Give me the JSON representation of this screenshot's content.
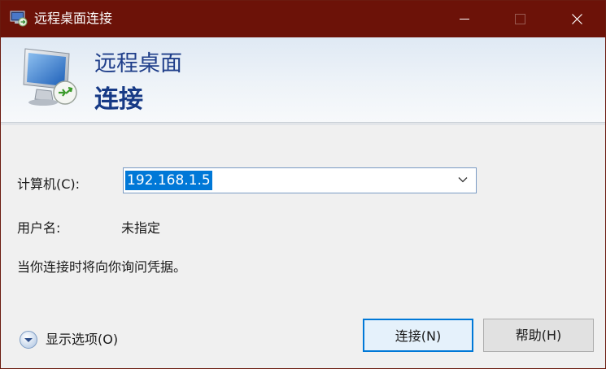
{
  "window": {
    "title": "远程桌面连接",
    "titlebar_color": "#6c1208",
    "minimize_icon": "minimize-icon",
    "maximize_icon": "maximize-icon",
    "close_icon": "close-icon"
  },
  "banner": {
    "line1": "远程桌面",
    "line2": "连接",
    "icon": "remote-desktop-monitor-icon"
  },
  "form": {
    "computer_label": "计算机(C):",
    "computer_value": "192.168.1.5",
    "username_label": "用户名:",
    "username_value": "未指定",
    "credential_note": "当你连接时将向你询问凭据。"
  },
  "footer": {
    "options_label": "显示选项(O)",
    "options_icon": "chevron-down-circle-icon",
    "connect_label": "连接(N)",
    "help_label": "帮助(H)"
  },
  "colors": {
    "accent": "#0078d7",
    "banner_text": "#1f3e8a"
  }
}
